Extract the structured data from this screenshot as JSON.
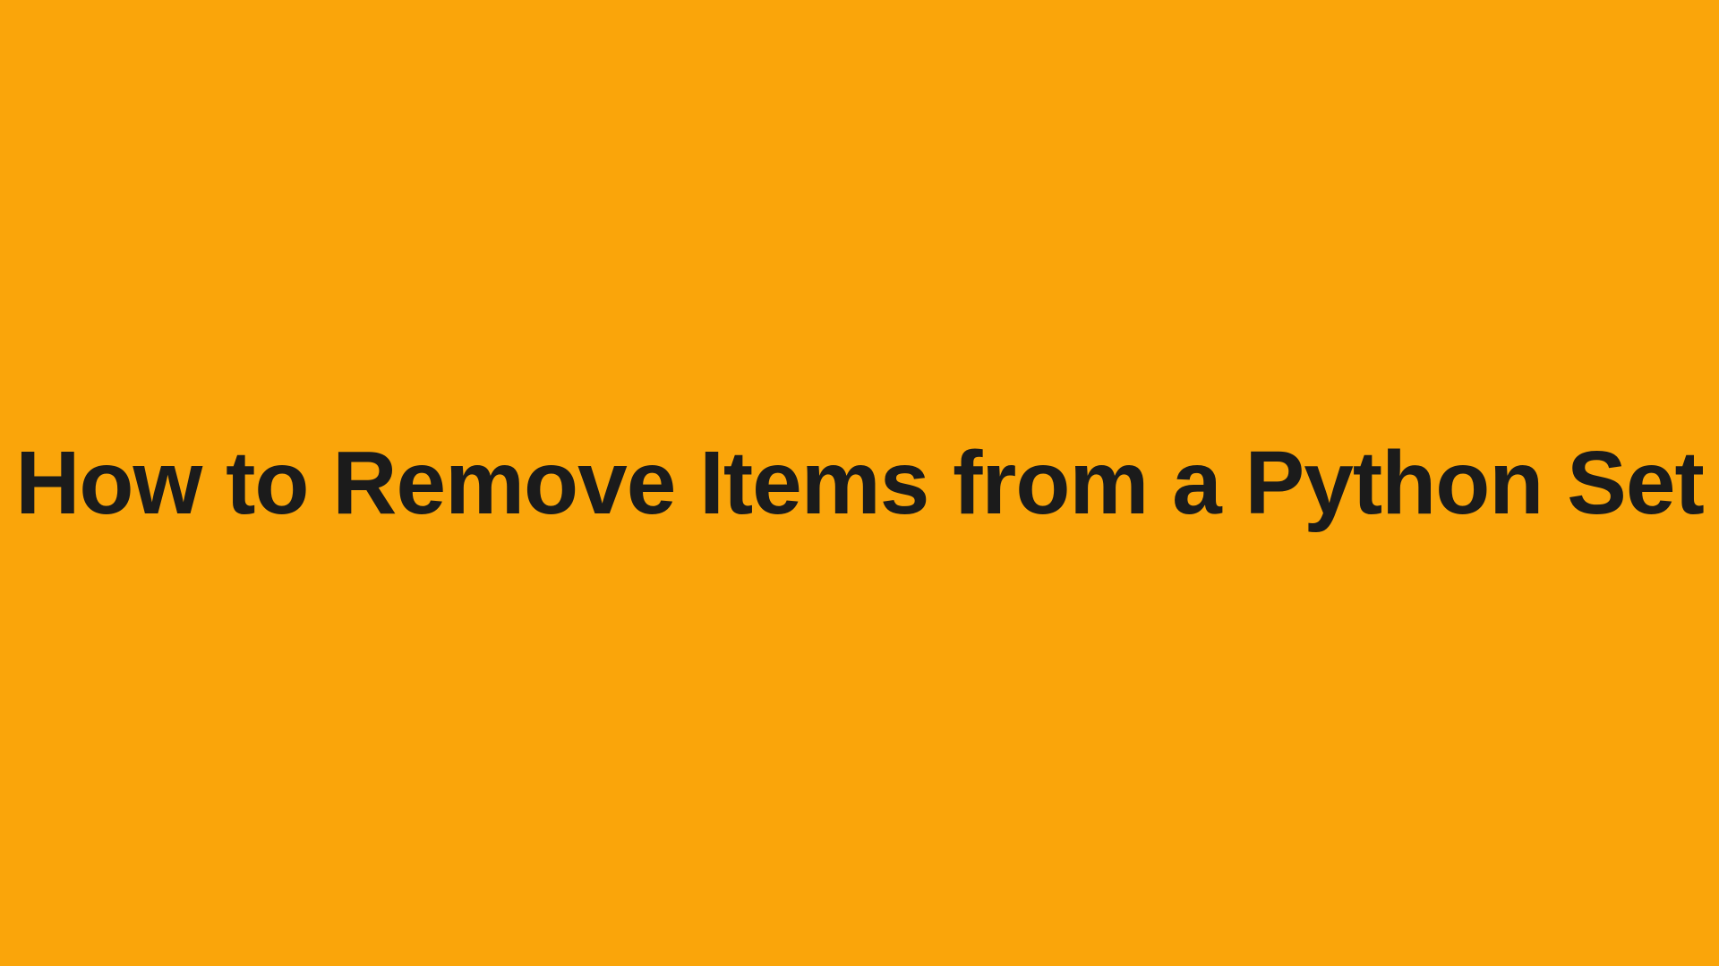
{
  "title": "How to Remove Items from a Python Set"
}
